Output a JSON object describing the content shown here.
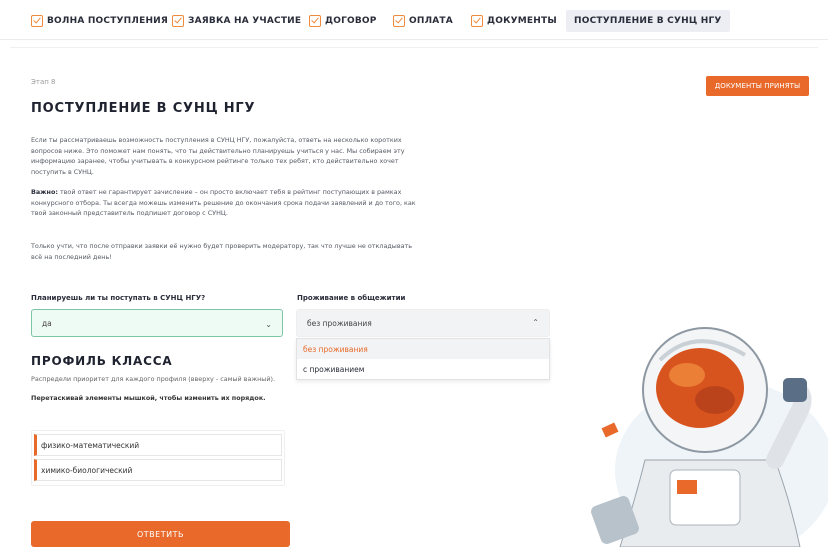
{
  "tabs": [
    {
      "label": "ВОЛНА ПОСТУПЛЕНИЯ",
      "checked": true
    },
    {
      "label": "ЗАЯВКА НА УЧАСТИЕ",
      "checked": true
    },
    {
      "label": "ДОГОВОР",
      "checked": true
    },
    {
      "label": "ОПЛАТА",
      "checked": true
    },
    {
      "label": "ДОКУМЕНТЫ",
      "checked": true
    },
    {
      "label": "ПОСТУПЛЕНИЕ В СУНЦ НГУ",
      "checked": false
    }
  ],
  "stage_label": "Этап 8",
  "status_badge": "ДОКУМЕНТЫ ПРИНЯТЫ",
  "page_title": "ПОСТУПЛЕНИЕ В СУНЦ НГУ",
  "intro": {
    "p1": "Если ты рассматриваешь возможность поступления в СУНЦ НГУ, пожалуйста, ответь на несколько коротких вопросов ниже. Это поможет нам понять, что ты действительно планируешь учиться у нас. Мы собираем эту информацию заранее, чтобы учитывать в конкурсном рейтинге только тех ребят, кто действительно хочет поступить в СУНЦ.",
    "p2_bold": "Важно:",
    "p2_rest": " твой ответ не гарантирует зачисление – он просто включает тебя в рейтинг поступающих в рамках конкурсного отбора. Ты всегда можешь изменить решение до окончания срока подачи заявлений и до того, как твой законный представитель подпишет договор с СУНЦ.",
    "p3": "Только учти, что после отправки заявки её нужно будет проверить модератору, так что лучше не откладывать всё на последний день!"
  },
  "question1": {
    "label": "Планируешь ли ты поступать в СУНЦ НГУ?",
    "value": "да"
  },
  "question2": {
    "label": "Проживание в общежитии",
    "value": "без проживания",
    "options": [
      "без проживания",
      "с проживанием"
    ]
  },
  "profile": {
    "title": "ПРОФИЛЬ КЛАССА",
    "description": "Распредели приоритет для каждого профиля (вверху - самый важный).",
    "drag_hint": "Перетаскивай элементы мышкой, чтобы изменить их порядок.",
    "items": [
      "физико-математический",
      "химико-биологический"
    ]
  },
  "submit_label": "ОТВЕТИТЬ",
  "colors": {
    "accent": "#e8692a",
    "check": "#f08a3c",
    "select_ok": "#7cc6a6"
  }
}
